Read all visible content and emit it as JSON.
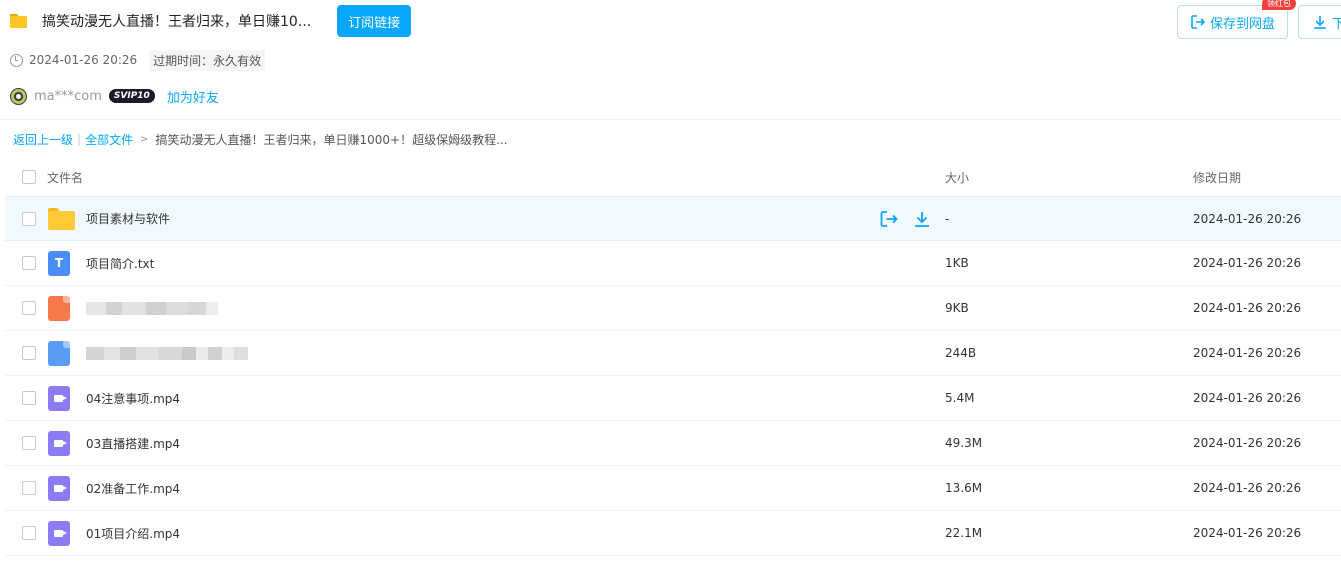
{
  "share": {
    "title": "搞笑动漫无人直播！王者归来，单日赚10...",
    "subscribe_label": "订阅链接",
    "date": "2024-01-26 20:26",
    "expire_label": "过期时间：永久有效",
    "username": "ma***com",
    "vip_badge": "SVIP10",
    "add_friend_label": "加为好友"
  },
  "actions": {
    "save_label": "保存到网盘",
    "download_label": "下",
    "redbag_label": "领红包"
  },
  "breadcrumb": {
    "back_label": "返回上一级",
    "all_files_label": "全部文件",
    "current": "搞笑动漫无人直播！王者归来，单日赚1000+！超级保姆级教程..."
  },
  "table": {
    "headers": {
      "name": "文件名",
      "size": "大小",
      "date": "修改日期"
    },
    "rows": [
      {
        "name": "项目素材与软件",
        "size": "-",
        "date": "2024-01-26 20:26",
        "icon": "folder-icon"
      },
      {
        "name": "项目简介.txt",
        "size": "1KB",
        "date": "2024-01-26 20:26",
        "icon": "txt-file-icon"
      },
      {
        "name": "",
        "size": "9KB",
        "date": "2024-01-26 20:26",
        "icon": "ppt-file-icon"
      },
      {
        "name": "",
        "size": "244B",
        "date": "2024-01-26 20:26",
        "icon": "generic-file-icon"
      },
      {
        "name": "04注意事项.mp4",
        "size": "5.4M",
        "date": "2024-01-26 20:26",
        "icon": "video-file-icon"
      },
      {
        "name": "03直播搭建.mp4",
        "size": "49.3M",
        "date": "2024-01-26 20:26",
        "icon": "video-file-icon"
      },
      {
        "name": "02准备工作.mp4",
        "size": "13.6M",
        "date": "2024-01-26 20:26",
        "icon": "video-file-icon"
      },
      {
        "name": "01项目介绍.mp4",
        "size": "22.1M",
        "date": "2024-01-26 20:26",
        "icon": "video-file-icon"
      }
    ]
  },
  "colors": {
    "accent": "#06a7ff",
    "hover_row": "#f2f9fe",
    "video_icon": "#8b7cf6"
  }
}
